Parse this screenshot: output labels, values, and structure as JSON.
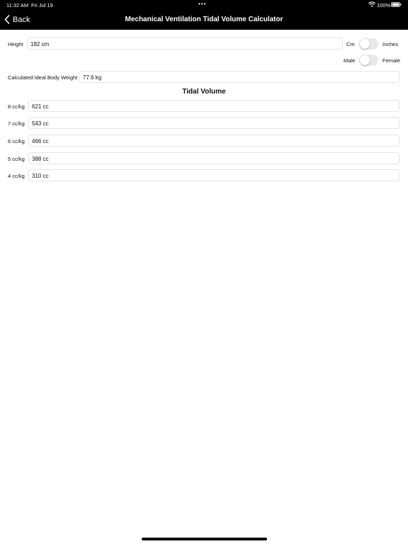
{
  "status_bar": {
    "time": "11:32 AM",
    "date": "Fri Jul 19",
    "dots": "•••",
    "battery_pct": "100%"
  },
  "nav": {
    "back_label": "Back",
    "title": "Mechanical Ventilation Tidal Volume Calculator"
  },
  "height": {
    "label": "Height",
    "value": "182 cm",
    "unit_left": "Cm",
    "unit_right": "Inches",
    "unit_toggle_on": false
  },
  "sex": {
    "left": "Male",
    "right": "Female",
    "toggle_on": false
  },
  "ibw": {
    "label": "Calculated Ideal Body Weight",
    "value": "77.6 kg"
  },
  "tidal_volume": {
    "title": "Tidal Volume",
    "rows": [
      {
        "label": "8 cc/kg",
        "value": "621 cc"
      },
      {
        "label": "7 cc/kg",
        "value": "543 cc"
      },
      {
        "label": "6 cc/kg",
        "value": "466 cc"
      },
      {
        "label": "5 cc/kg",
        "value": "388 cc"
      },
      {
        "label": "4 cc/kg",
        "value": "310 cc"
      }
    ]
  }
}
